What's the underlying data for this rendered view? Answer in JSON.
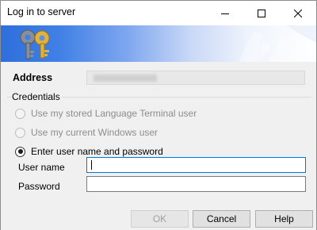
{
  "window": {
    "title": "Log in to server"
  },
  "titlebar_buttons": {
    "minimize": "minimize-icon",
    "maximize": "maximize-icon",
    "close": "close-icon"
  },
  "banner": {
    "icon": "keys-icon",
    "start_color": "#2f6fdc",
    "end_color": "#ffffff"
  },
  "address": {
    "label": "Address",
    "value": ""
  },
  "credentials": {
    "group_label": "Credentials",
    "options": [
      {
        "label": "Use my stored Language Terminal user",
        "checked": false,
        "enabled": false
      },
      {
        "label": "Use my current Windows user",
        "checked": false,
        "enabled": false
      },
      {
        "label": "Enter user name and password",
        "checked": true,
        "enabled": true
      }
    ],
    "username_label": "User name",
    "username_value": "",
    "password_label": "Password",
    "password_value": ""
  },
  "buttons": {
    "ok": "OK",
    "cancel": "Cancel",
    "help": "Help"
  },
  "colors": {
    "focus_border": "#0078d7",
    "disabled_text": "#8d8d8d"
  }
}
